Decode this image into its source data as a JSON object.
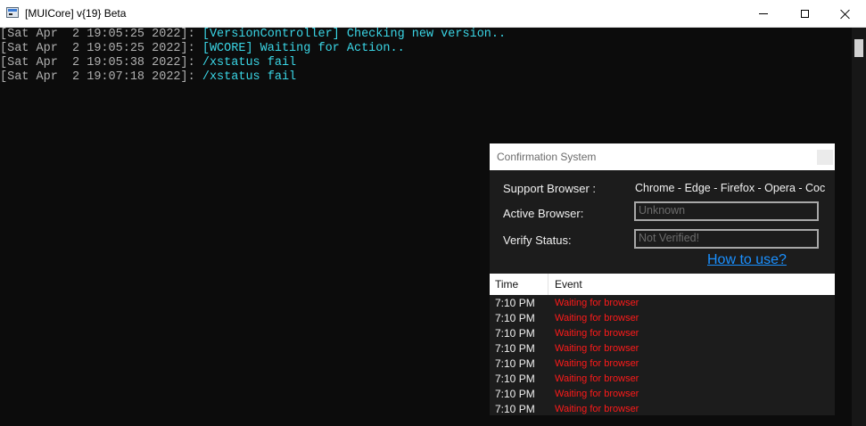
{
  "window": {
    "title": "[MUICore] v{19} Beta",
    "icon": "console-app-icon"
  },
  "console": {
    "lines": [
      {
        "timestamp": "[Sat Apr  2 19:05:25 2022]: ",
        "message": "[VersionController] Checking new version.."
      },
      {
        "timestamp": "[Sat Apr  2 19:05:25 2022]: ",
        "message": "[WCORE] Waiting for Action.."
      },
      {
        "timestamp": "[Sat Apr  2 19:05:38 2022]: ",
        "message": "/xstatus fail"
      },
      {
        "timestamp": "[Sat Apr  2 19:07:18 2022]: ",
        "message": "/xstatus fail"
      }
    ],
    "colors": {
      "background": "#0c0c0c",
      "timestamp": "#b0b0b0",
      "message": "#3ad6e6"
    }
  },
  "dialog": {
    "title": "Confirmation System",
    "support_label": "Support Browser :",
    "support_value": "Chrome - Edge - Firefox - Opera - Coc",
    "active_label": "Active Browser:",
    "active_placeholder": "Unknown",
    "verify_label": "Verify Status:",
    "verify_placeholder": "Not Verified!",
    "help_link": "How to use?",
    "columns": {
      "time": "Time",
      "event": "Event"
    },
    "rows": [
      {
        "time": "7:10 PM",
        "event": "Waiting for browser"
      },
      {
        "time": "7:10 PM",
        "event": "Waiting for browser"
      },
      {
        "time": "7:10 PM",
        "event": "Waiting for browser"
      },
      {
        "time": "7:10 PM",
        "event": "Waiting for browser"
      },
      {
        "time": "7:10 PM",
        "event": "Waiting for browser"
      },
      {
        "time": "7:10 PM",
        "event": "Waiting for browser"
      },
      {
        "time": "7:10 PM",
        "event": "Waiting for browser"
      },
      {
        "time": "7:10 PM",
        "event": "Waiting for browser"
      }
    ],
    "colors": {
      "background": "#1c1c1c",
      "event_text": "#ff1a1a",
      "link": "#1a90ff"
    }
  }
}
